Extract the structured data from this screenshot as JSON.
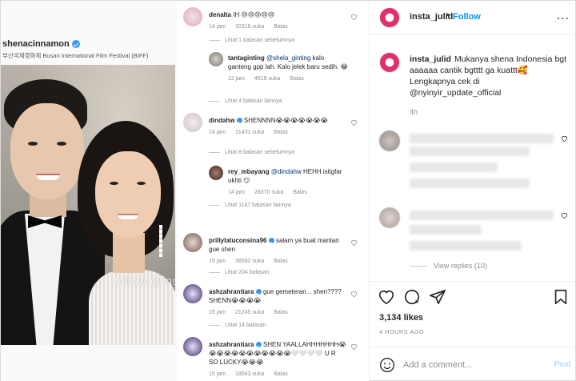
{
  "media": {
    "embedded_account": "shenacinnamon",
    "embedded_subtitle": "부산국제영화제 Busan International Film Festival (BIFF)",
    "watermark": "follow @insta_julid",
    "comments": [
      {
        "user": "denalta",
        "text": "IH 😢😢😢😢😢",
        "time": "14 jam",
        "likes": "10318 suka",
        "reply": "Balas"
      },
      {
        "more": "Lihat 1 balasan sebelumnya"
      },
      {
        "user": "tantaginting",
        "mention": "@shela_ginting",
        "text": " kalo ganteng gpp lah. Kalo jelek baru sedih. 😂",
        "time": "12 jam",
        "likes": "4618 suka",
        "reply": "Balas"
      },
      {
        "more": "Lihat 4 balasan lainnya"
      },
      {
        "user": "dindahw",
        "text": "SHENNNN😭😭😭😭😭😭😭",
        "time": "14 jam",
        "likes": "31431 suka",
        "reply": "Balas"
      },
      {
        "more": "Lihat 8 balasan sebelumnya"
      },
      {
        "user": "rey_mbayang",
        "mention": "@dindahw",
        "text": " HEHH istigfar ukhti 😏",
        "time": "14 jam",
        "likes": "28370 suka",
        "reply": "Balas"
      },
      {
        "more": "Lihat 1147 balasan lainnya"
      },
      {
        "user": "prillylatuconsina96",
        "text": "salam ya buat mantan gue shen",
        "time": "15 jam",
        "likes": "36582 suka",
        "reply": "Balas"
      },
      {
        "more": "Lihat 204 balasan"
      },
      {
        "user": "ashzahrantiara",
        "text": "gue gemeteran... shen???? SHENN😭😭😭😭",
        "time": "15 jam",
        "likes": "21245 suka",
        "reply": "Balas"
      },
      {
        "more": "Lihat 14 balasan"
      },
      {
        "user": "ashzahrantiara",
        "text": "SHEN YAALLAHHHHHHH😭😭😭😭😭😭😭😭😭😭😭😭🤍🤍🤍🤍 U R SO LUCKY😭😭😭",
        "time": "15 jam",
        "likes": "18563 suka",
        "reply": "Balas"
      }
    ]
  },
  "header": {
    "username": "insta_julid",
    "dot": "•",
    "follow_label": "Follow",
    "menu": "..."
  },
  "caption": {
    "username": "insta_julid",
    "text": "Mukanya shena Indonesia bgt aaaaaa cantik bgtttt ga kuattt🥰 Lengkapnya cek di @nyinyir_update_official",
    "time": "4h"
  },
  "replies": {
    "view_label": "View replies (10)"
  },
  "actions": {
    "likes": "3,134 likes",
    "ago": "4 HOURS AGO"
  },
  "comment_box": {
    "placeholder": "Add a comment...",
    "post_label": "Post"
  },
  "colors": {
    "accent": "#0095f6",
    "post_disabled": "#b2dffc",
    "muted": "#8e8e8e",
    "text": "#262626"
  }
}
